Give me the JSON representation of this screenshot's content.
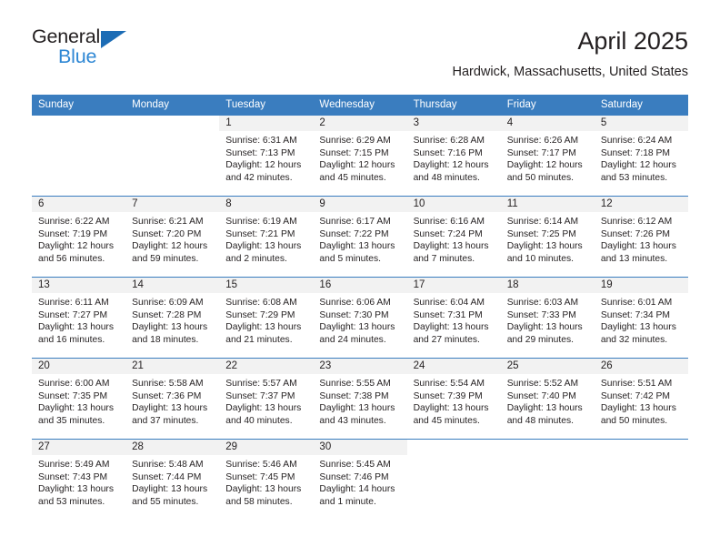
{
  "brand": {
    "name_part1": "General",
    "name_part2": "Blue",
    "triangle_color": "#1c6cb5",
    "blue_color": "#2e87d4"
  },
  "header": {
    "month_title": "April 2025",
    "location": "Hardwick, Massachusetts, United States"
  },
  "theme": {
    "header_row_bg": "#3a7dbf",
    "daynum_bg": "#f2f2f2",
    "text_color": "#231f20"
  },
  "calendar": {
    "weekday_headers": [
      "Sunday",
      "Monday",
      "Tuesday",
      "Wednesday",
      "Thursday",
      "Friday",
      "Saturday"
    ],
    "weeks": [
      [
        {
          "day": "",
          "lines": []
        },
        {
          "day": "",
          "lines": []
        },
        {
          "day": "1",
          "lines": [
            "Sunrise: 6:31 AM",
            "Sunset: 7:13 PM",
            "Daylight: 12 hours",
            "and 42 minutes."
          ]
        },
        {
          "day": "2",
          "lines": [
            "Sunrise: 6:29 AM",
            "Sunset: 7:15 PM",
            "Daylight: 12 hours",
            "and 45 minutes."
          ]
        },
        {
          "day": "3",
          "lines": [
            "Sunrise: 6:28 AM",
            "Sunset: 7:16 PM",
            "Daylight: 12 hours",
            "and 48 minutes."
          ]
        },
        {
          "day": "4",
          "lines": [
            "Sunrise: 6:26 AM",
            "Sunset: 7:17 PM",
            "Daylight: 12 hours",
            "and 50 minutes."
          ]
        },
        {
          "day": "5",
          "lines": [
            "Sunrise: 6:24 AM",
            "Sunset: 7:18 PM",
            "Daylight: 12 hours",
            "and 53 minutes."
          ]
        }
      ],
      [
        {
          "day": "6",
          "lines": [
            "Sunrise: 6:22 AM",
            "Sunset: 7:19 PM",
            "Daylight: 12 hours",
            "and 56 minutes."
          ]
        },
        {
          "day": "7",
          "lines": [
            "Sunrise: 6:21 AM",
            "Sunset: 7:20 PM",
            "Daylight: 12 hours",
            "and 59 minutes."
          ]
        },
        {
          "day": "8",
          "lines": [
            "Sunrise: 6:19 AM",
            "Sunset: 7:21 PM",
            "Daylight: 13 hours",
            "and 2 minutes."
          ]
        },
        {
          "day": "9",
          "lines": [
            "Sunrise: 6:17 AM",
            "Sunset: 7:22 PM",
            "Daylight: 13 hours",
            "and 5 minutes."
          ]
        },
        {
          "day": "10",
          "lines": [
            "Sunrise: 6:16 AM",
            "Sunset: 7:24 PM",
            "Daylight: 13 hours",
            "and 7 minutes."
          ]
        },
        {
          "day": "11",
          "lines": [
            "Sunrise: 6:14 AM",
            "Sunset: 7:25 PM",
            "Daylight: 13 hours",
            "and 10 minutes."
          ]
        },
        {
          "day": "12",
          "lines": [
            "Sunrise: 6:12 AM",
            "Sunset: 7:26 PM",
            "Daylight: 13 hours",
            "and 13 minutes."
          ]
        }
      ],
      [
        {
          "day": "13",
          "lines": [
            "Sunrise: 6:11 AM",
            "Sunset: 7:27 PM",
            "Daylight: 13 hours",
            "and 16 minutes."
          ]
        },
        {
          "day": "14",
          "lines": [
            "Sunrise: 6:09 AM",
            "Sunset: 7:28 PM",
            "Daylight: 13 hours",
            "and 18 minutes."
          ]
        },
        {
          "day": "15",
          "lines": [
            "Sunrise: 6:08 AM",
            "Sunset: 7:29 PM",
            "Daylight: 13 hours",
            "and 21 minutes."
          ]
        },
        {
          "day": "16",
          "lines": [
            "Sunrise: 6:06 AM",
            "Sunset: 7:30 PM",
            "Daylight: 13 hours",
            "and 24 minutes."
          ]
        },
        {
          "day": "17",
          "lines": [
            "Sunrise: 6:04 AM",
            "Sunset: 7:31 PM",
            "Daylight: 13 hours",
            "and 27 minutes."
          ]
        },
        {
          "day": "18",
          "lines": [
            "Sunrise: 6:03 AM",
            "Sunset: 7:33 PM",
            "Daylight: 13 hours",
            "and 29 minutes."
          ]
        },
        {
          "day": "19",
          "lines": [
            "Sunrise: 6:01 AM",
            "Sunset: 7:34 PM",
            "Daylight: 13 hours",
            "and 32 minutes."
          ]
        }
      ],
      [
        {
          "day": "20",
          "lines": [
            "Sunrise: 6:00 AM",
            "Sunset: 7:35 PM",
            "Daylight: 13 hours",
            "and 35 minutes."
          ]
        },
        {
          "day": "21",
          "lines": [
            "Sunrise: 5:58 AM",
            "Sunset: 7:36 PM",
            "Daylight: 13 hours",
            "and 37 minutes."
          ]
        },
        {
          "day": "22",
          "lines": [
            "Sunrise: 5:57 AM",
            "Sunset: 7:37 PM",
            "Daylight: 13 hours",
            "and 40 minutes."
          ]
        },
        {
          "day": "23",
          "lines": [
            "Sunrise: 5:55 AM",
            "Sunset: 7:38 PM",
            "Daylight: 13 hours",
            "and 43 minutes."
          ]
        },
        {
          "day": "24",
          "lines": [
            "Sunrise: 5:54 AM",
            "Sunset: 7:39 PM",
            "Daylight: 13 hours",
            "and 45 minutes."
          ]
        },
        {
          "day": "25",
          "lines": [
            "Sunrise: 5:52 AM",
            "Sunset: 7:40 PM",
            "Daylight: 13 hours",
            "and 48 minutes."
          ]
        },
        {
          "day": "26",
          "lines": [
            "Sunrise: 5:51 AM",
            "Sunset: 7:42 PM",
            "Daylight: 13 hours",
            "and 50 minutes."
          ]
        }
      ],
      [
        {
          "day": "27",
          "lines": [
            "Sunrise: 5:49 AM",
            "Sunset: 7:43 PM",
            "Daylight: 13 hours",
            "and 53 minutes."
          ]
        },
        {
          "day": "28",
          "lines": [
            "Sunrise: 5:48 AM",
            "Sunset: 7:44 PM",
            "Daylight: 13 hours",
            "and 55 minutes."
          ]
        },
        {
          "day": "29",
          "lines": [
            "Sunrise: 5:46 AM",
            "Sunset: 7:45 PM",
            "Daylight: 13 hours",
            "and 58 minutes."
          ]
        },
        {
          "day": "30",
          "lines": [
            "Sunrise: 5:45 AM",
            "Sunset: 7:46 PM",
            "Daylight: 14 hours",
            "and 1 minute."
          ]
        },
        {
          "day": "",
          "lines": []
        },
        {
          "day": "",
          "lines": []
        },
        {
          "day": "",
          "lines": []
        }
      ]
    ]
  }
}
